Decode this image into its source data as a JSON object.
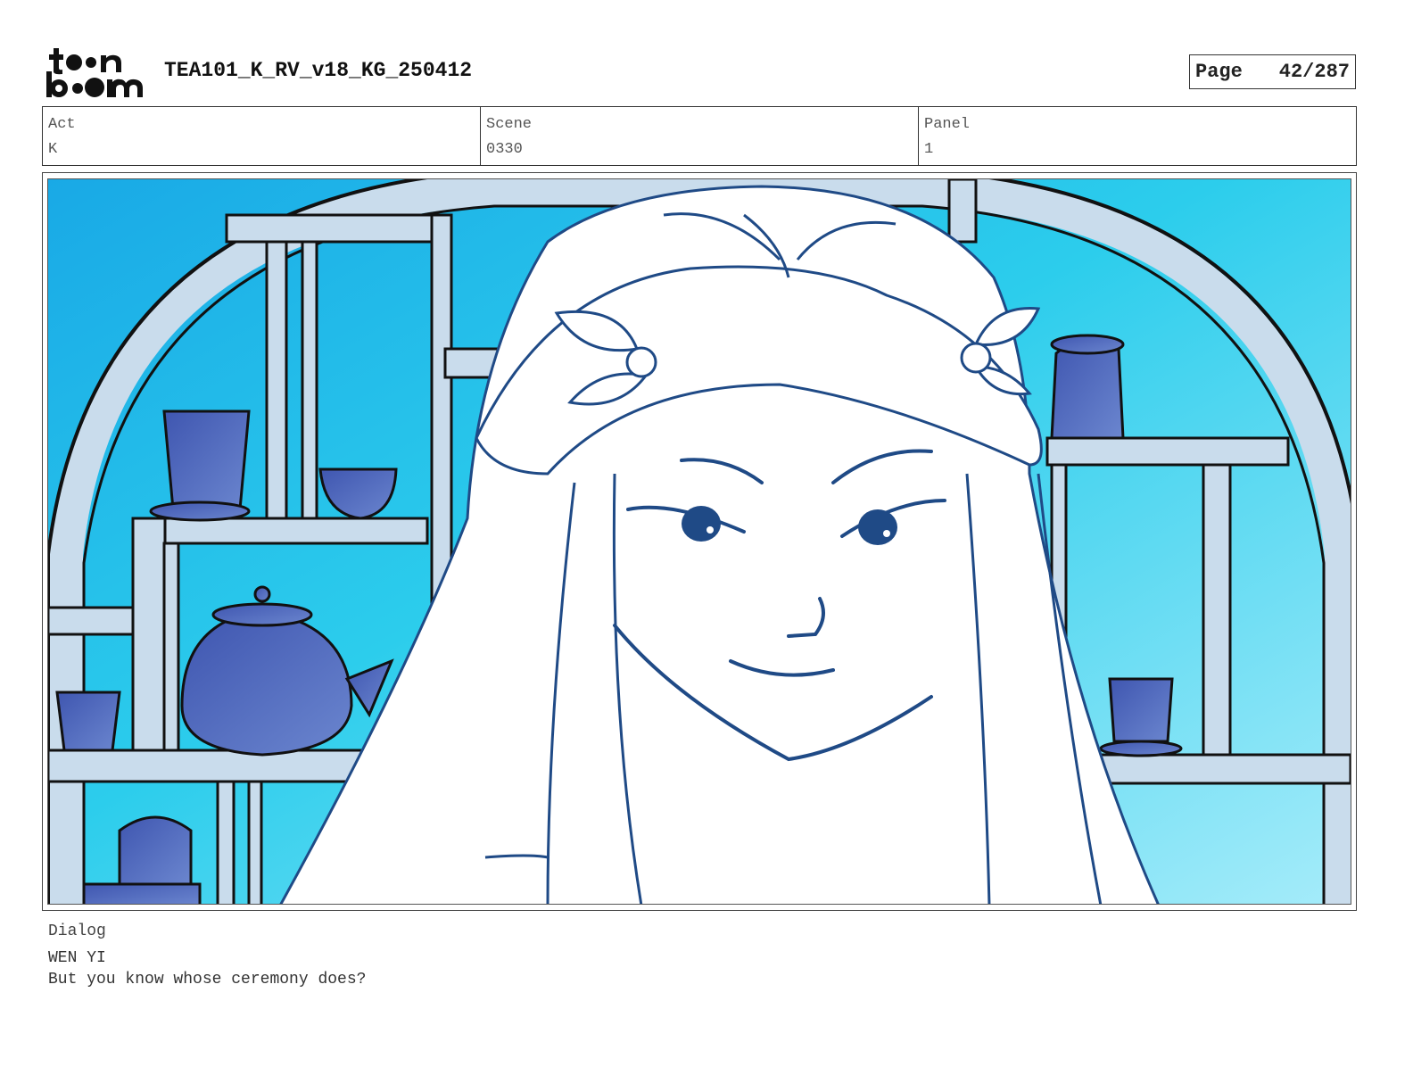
{
  "header": {
    "doc_title": "TEA101_K_RV_v18_KG_250412",
    "page_label": "Page",
    "page_number": "42/287"
  },
  "meta": {
    "act_label": "Act",
    "act_value": "K",
    "scene_label": "Scene",
    "scene_value": "0330",
    "panel_label": "Panel",
    "panel_value": "1"
  },
  "dialog": {
    "label": "Dialog",
    "speaker": "WEN YI",
    "line": "But you know whose ceremony does?"
  },
  "colors": {
    "line_art": "#1f4a86",
    "sky_light": "#7fe3f7",
    "sky_mid": "#2ec4ea",
    "shelf": "#c9dcec",
    "pottery": "#4d6bbf"
  }
}
